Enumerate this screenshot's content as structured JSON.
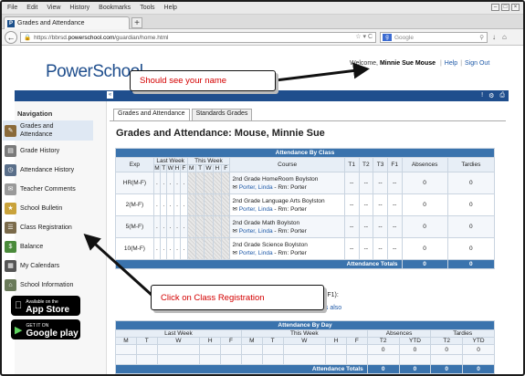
{
  "browser": {
    "menu": [
      "File",
      "Edit",
      "View",
      "History",
      "Bookmarks",
      "Tools",
      "Help"
    ],
    "tab_title": "Grades and Attendance",
    "url_prefix": "https://bbrsd.",
    "url_host": "powerschool.com",
    "url_path": "/guardian/home.html",
    "search_placeholder": "Google"
  },
  "header": {
    "logo": "PowerSchool",
    "welcome_prefix": "Welcome,",
    "user_name": "Minnie Sue Mouse",
    "help": "Help",
    "signout": "Sign Out"
  },
  "nav": {
    "heading": "Navigation",
    "items": [
      {
        "label": "Grades and",
        "label2": "Attendance",
        "icon": "gradebook-icon",
        "color": "#8a6a3a"
      },
      {
        "label": "Grade History",
        "icon": "grade-history-icon",
        "color": "#7a7a7a"
      },
      {
        "label": "Attendance History",
        "icon": "clock-icon",
        "color": "#5a6f8a"
      },
      {
        "label": "Teacher Comments",
        "icon": "comments-icon",
        "color": "#9a9a9a"
      },
      {
        "label": "School Bulletin",
        "icon": "bulletin-icon",
        "color": "#c9a23a"
      },
      {
        "label": "Class Registration",
        "icon": "registration-icon",
        "color": "#7a6a4a"
      },
      {
        "label": "Balance",
        "icon": "balance-icon",
        "color": "#4a8a3a"
      },
      {
        "label": "My Calendars",
        "icon": "calendar-icon",
        "color": "#555"
      },
      {
        "label": "School Information",
        "icon": "school-icon",
        "color": "#6a7a5a"
      }
    ],
    "appstore_small": "Available on the",
    "appstore_big": "App Store",
    "googleplay_small": "GET IT ON",
    "googleplay_big": "Google play"
  },
  "content": {
    "tabs": [
      "Grades and Attendance",
      "Standards Grades"
    ],
    "title": "Grades and Attendance: Mouse, Minnie Sue",
    "by_class": {
      "title": "Attendance By Class",
      "headers": {
        "exp": "Exp",
        "last_week": "Last Week",
        "this_week": "This Week",
        "days": [
          "M",
          "T",
          "W",
          "H",
          "F"
        ],
        "course": "Course",
        "t1": "T1",
        "t2": "T2",
        "t3": "T3",
        "f1": "F1",
        "absences": "Absences",
        "tardies": "Tardies"
      },
      "rows": [
        {
          "exp": "HR(M-F)",
          "course": "2nd Grade HomeRoom Boylston",
          "teacher": "Porter, Linda",
          "room": " - Rm: Porter",
          "t1": "--",
          "t2": "--",
          "t3": "--",
          "f1": "--",
          "absences": "0",
          "tardies": "0"
        },
        {
          "exp": "2(M-F)",
          "course": "2nd Grade Language Arts Boylston",
          "teacher": "Porter, Linda",
          "room": " - Rm: Porter",
          "t1": "--",
          "t2": "--",
          "t3": "--",
          "f1": "--",
          "absences": "0",
          "tardies": "0"
        },
        {
          "exp": "5(M-F)",
          "course": "2nd Grade Math Boylston",
          "teacher": "Porter, Linda",
          "room": " - Rm: Porter",
          "t1": "--",
          "t2": "--",
          "t3": "--",
          "f1": "--",
          "absences": "0",
          "tardies": "0"
        },
        {
          "exp": "10(M-F)",
          "course": "2nd Grade Science Boylston",
          "teacher": "Porter, Linda",
          "room": " - Rm: Porter",
          "t1": "--",
          "t2": "--",
          "t3": "--",
          "f1": "--",
          "absences": "0",
          "tardies": "0"
        }
      ],
      "totals_label": "Attendance Totals",
      "total_absences": "0",
      "total_tardies": "0"
    },
    "partial_text1": "(F1):",
    "partial_text2": "es also",
    "by_day": {
      "title": "Attendance By Day",
      "last_week": "Last Week",
      "this_week": "This Week",
      "absences": "Absences",
      "tardies": "Tardies",
      "days": [
        "M",
        "T",
        "W",
        "H",
        "F"
      ],
      "t2": "T2",
      "ytd": "YTD",
      "values": [
        "0",
        "0",
        "0",
        "0"
      ],
      "totals_label": "Attendance Totals",
      "totals": [
        "0",
        "0",
        "0",
        "0"
      ]
    }
  },
  "callouts": {
    "top": "Should see your name",
    "bottom": "Click on Class Registration"
  }
}
